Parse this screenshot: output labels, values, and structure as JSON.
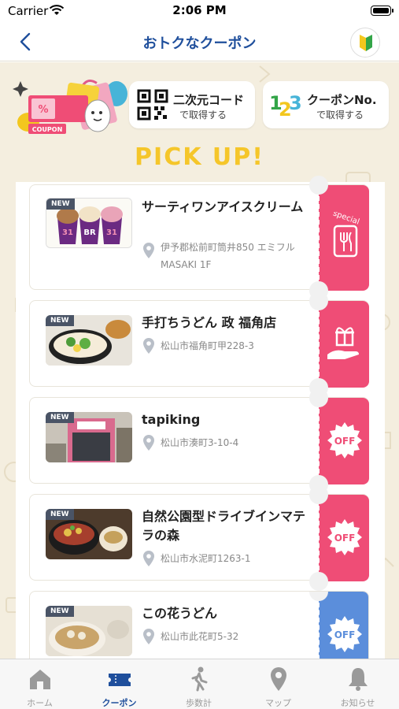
{
  "status_bar": {
    "carrier": "Carrier",
    "time": "2:06 PM"
  },
  "nav": {
    "title": "おトクなクーポン"
  },
  "hero": {
    "coupon_label": "COUPON"
  },
  "code_buttons": [
    {
      "title": "二次元コード",
      "sub": "で取得する"
    },
    {
      "title": "クーポンNo.",
      "sub": "で取得する",
      "icon_text": "123"
    }
  ],
  "pickup_title": "PICK UP!",
  "coupons": [
    {
      "title": "サーティワンアイスクリーム",
      "address": "伊予郡松前町筒井850 エミフルMASAKI 1F",
      "badge": "NEW",
      "tab_type": "special",
      "tab_label": "special",
      "tab_color": "#ef4d76"
    },
    {
      "title": "手打ちうどん 政 福角店",
      "address": "松山市福角町甲228-3",
      "badge": "NEW",
      "tab_type": "gift",
      "tab_color": "#ef4d76"
    },
    {
      "title": "tapiking",
      "address": "松山市湊町3-10-4",
      "badge": "NEW",
      "tab_type": "off",
      "tab_label": "OFF",
      "tab_color": "#ef4d76"
    },
    {
      "title": "自然公園型ドライブインマテラの森",
      "address": "松山市水泥町1263-1",
      "badge": "NEW",
      "tab_type": "off",
      "tab_label": "OFF",
      "tab_color": "#ef4d76"
    },
    {
      "title": "この花うどん",
      "address": "松山市此花町5-32",
      "badge": "NEW",
      "tab_type": "off",
      "tab_label": "OFF",
      "tab_color": "#5b8edb"
    }
  ],
  "tabbar": {
    "items": [
      {
        "label": "ホーム",
        "icon": "home-icon"
      },
      {
        "label": "クーポン",
        "icon": "ticket-icon",
        "active": true
      },
      {
        "label": "歩数計",
        "icon": "walking-icon"
      },
      {
        "label": "マップ",
        "icon": "map-pin-icon"
      },
      {
        "label": "お知らせ",
        "icon": "bell-icon"
      }
    ]
  },
  "colors": {
    "accent": "#1f4f9c",
    "pink": "#ef4d76",
    "blue": "#5b8edb",
    "pickup": "#f5c62a",
    "background": "#f4eedf"
  }
}
